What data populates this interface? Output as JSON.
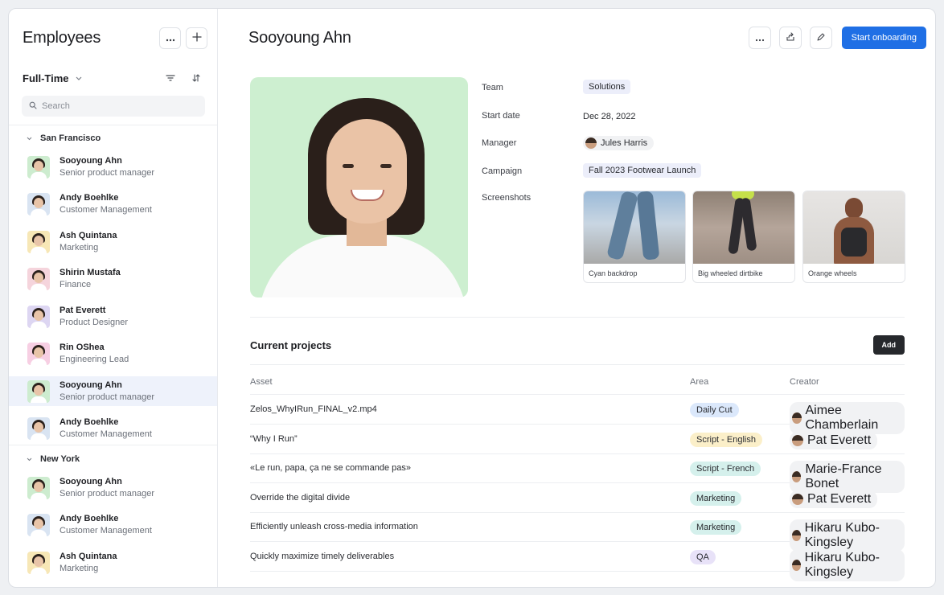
{
  "sidebar": {
    "title": "Employees",
    "filter_label": "Full-Time",
    "search_placeholder": "Search",
    "groups": [
      {
        "name": "San Francisco",
        "employees": [
          {
            "name": "Sooyoung Ahn",
            "role": "Senior product manager",
            "avatar_bg": "#cdeccf",
            "selected": false
          },
          {
            "name": "Andy Boehlke",
            "role": "Customer Management",
            "avatar_bg": "#d9e4f2",
            "selected": false
          },
          {
            "name": "Ash Quintana",
            "role": "Marketing",
            "avatar_bg": "#f7e7b6",
            "selected": false
          },
          {
            "name": "Shirin Mustafa",
            "role": "Finance",
            "avatar_bg": "#f5d4dc",
            "selected": false
          },
          {
            "name": "Pat Everett",
            "role": "Product Designer",
            "avatar_bg": "#ddd6f2",
            "selected": false
          },
          {
            "name": "Rin OShea",
            "role": "Engineering Lead",
            "avatar_bg": "#f7cfe3",
            "selected": false
          },
          {
            "name": "Sooyoung Ahn",
            "role": "Senior product manager",
            "avatar_bg": "#cdeccf",
            "selected": true
          },
          {
            "name": "Andy Boehlke",
            "role": "Customer Management",
            "avatar_bg": "#d9e4f2",
            "selected": false
          }
        ]
      },
      {
        "name": "New York",
        "employees": [
          {
            "name": "Sooyoung Ahn",
            "role": "Senior product manager",
            "avatar_bg": "#cdeccf",
            "selected": false
          },
          {
            "name": "Andy Boehlke",
            "role": "Customer Management",
            "avatar_bg": "#d9e4f2",
            "selected": false
          },
          {
            "name": "Ash Quintana",
            "role": "Marketing",
            "avatar_bg": "#f7e7b6",
            "selected": false
          }
        ]
      }
    ]
  },
  "profile": {
    "name": "Sooyoung Ahn",
    "primary_action": "Start onboarding",
    "fields": {
      "team_label": "Team",
      "team_value": "Solutions",
      "start_label": "Start date",
      "start_value": "Dec 28, 2022",
      "manager_label": "Manager",
      "manager_value": "Jules Harris",
      "campaign_label": "Campaign",
      "campaign_value": "Fall 2023 Footwear Launch",
      "screenshots_label": "Screenshots"
    },
    "screenshots": [
      {
        "caption": "Cyan backdrop"
      },
      {
        "caption": "Big wheeled dirtbike"
      },
      {
        "caption": "Orange wheels"
      }
    ]
  },
  "projects": {
    "title": "Current projects",
    "add_label": "Add",
    "columns": {
      "asset": "Asset",
      "area": "Area",
      "creator": "Creator"
    },
    "rows": [
      {
        "asset": "Zelos_WhyIRun_FINAL_v2.mp4",
        "area": "Daily Cut",
        "area_style": "blue",
        "creator": "Aimee Chamberlain"
      },
      {
        "asset": "“Why I Run”",
        "area": "Script - English",
        "area_style": "yellow",
        "creator": "Pat Everett"
      },
      {
        "asset": "«Le run, papa, ça ne se commande pas»",
        "area": "Script - French",
        "area_style": "teal",
        "creator": "Marie-France Bonet"
      },
      {
        "asset": "Override the digital divide",
        "area": "Marketing",
        "area_style": "teal",
        "creator": "Pat Everett"
      },
      {
        "asset": "Efficiently unleash cross-media information",
        "area": "Marketing",
        "area_style": "teal",
        "creator": "Hikaru Kubo-Kingsley"
      },
      {
        "asset": "Quickly maximize timely deliverables",
        "area": "QA",
        "area_style": "purple",
        "creator": "Hikaru Kubo-Kingsley"
      }
    ]
  },
  "colors": {
    "primary": "#1f6fe5",
    "selected_row": "#eef2fb",
    "photo_bg": "#cdefd0"
  },
  "icons": {
    "more": "more-horizontal-icon",
    "add": "plus-icon",
    "filter": "filter-icon",
    "sort": "sort-icon",
    "search": "search-icon",
    "share": "share-icon",
    "edit": "pencil-icon"
  }
}
